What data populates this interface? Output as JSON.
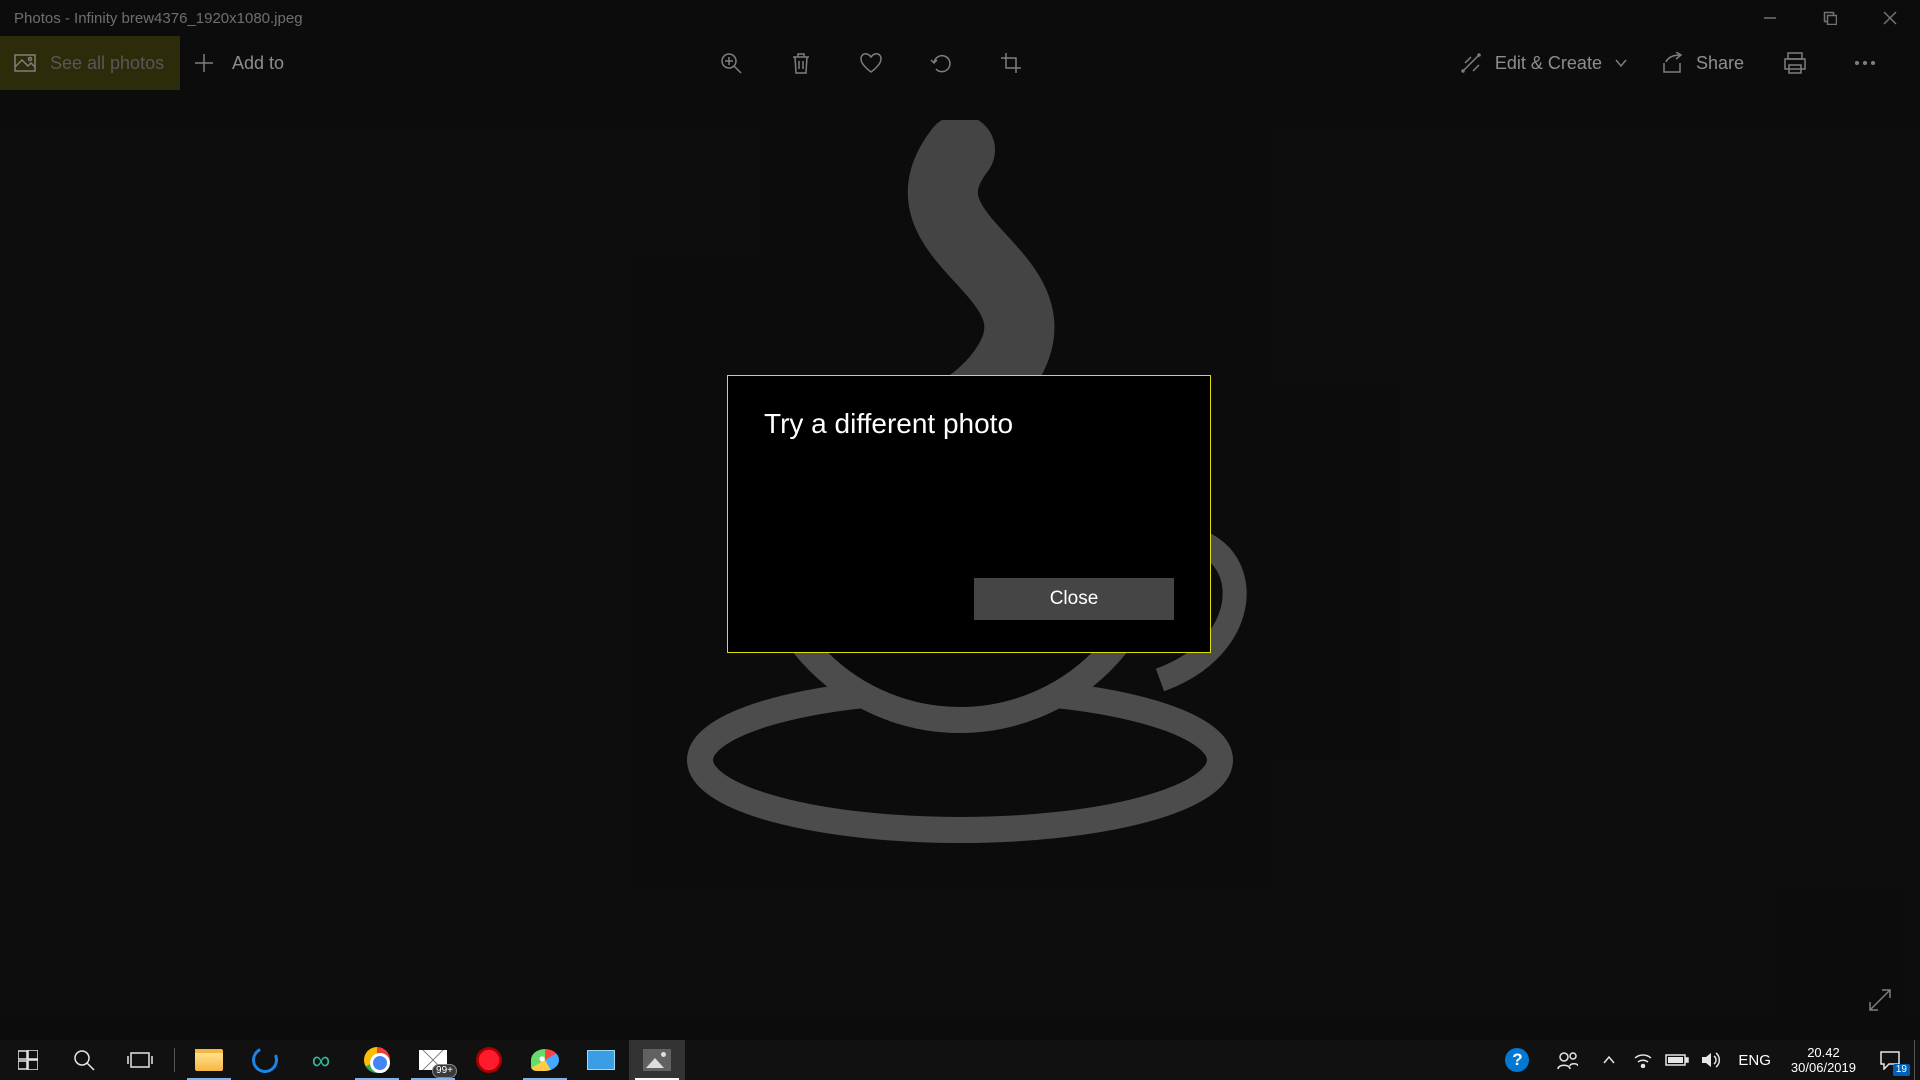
{
  "window": {
    "title": "Photos - Infinity brew4376_1920x1080.jpeg"
  },
  "toolbar": {
    "see_all_label": "See all photos",
    "add_to_label": "Add to",
    "edit_create_label": "Edit & Create",
    "share_label": "Share"
  },
  "dialog": {
    "heading": "Try a different photo",
    "close_label": "Close"
  },
  "taskbar": {
    "mail_badge": "99+",
    "help_glyph": "?",
    "infinity_glyph": "∞",
    "language": "ENG",
    "time": "20.42",
    "date": "30/06/2019",
    "action_center_badge": "19"
  }
}
